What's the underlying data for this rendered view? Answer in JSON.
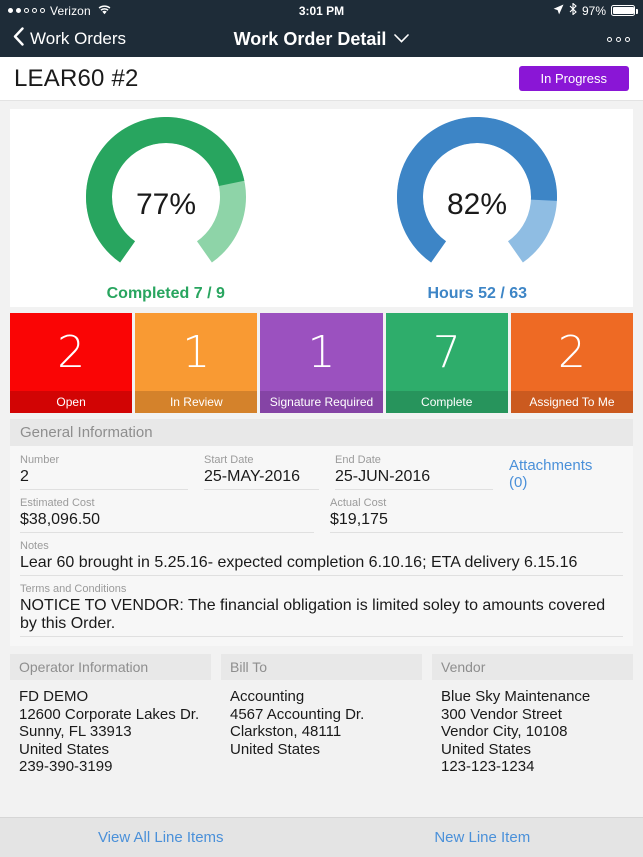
{
  "statusbar": {
    "carrier": "Verizon",
    "signal_dots_filled": 2,
    "signal_dots_total": 5,
    "wifi_icon": "wifi-icon",
    "time": "3:01 PM",
    "location_icon": "location-arrow-icon",
    "bluetooth_icon": "bluetooth-icon",
    "battery_percent": "97%",
    "battery_level": 97
  },
  "navbar": {
    "back_icon": "chevron-left-icon",
    "back_label": "Work Orders",
    "title": "Work Order Detail",
    "title_dropdown_icon": "chevron-down-icon",
    "more_icon": "more-horizontal-icon"
  },
  "header": {
    "work_order_title": "LEAR60 #2",
    "status_label": "In Progress",
    "status_color": "#8a16d6"
  },
  "gauges": [
    {
      "name": "completed",
      "percent_label": "77%",
      "percent_value": 77,
      "caption": "Completed 7 / 9",
      "completed": 7,
      "total": 9,
      "color": "#28a55f",
      "track_color": "#8ed4a8"
    },
    {
      "name": "hours",
      "percent_label": "82%",
      "percent_value": 82,
      "caption": "Hours 52 / 63",
      "completed": 52,
      "total": 63,
      "color": "#3d85c6",
      "track_color": "#8fbde3"
    }
  ],
  "tiles": [
    {
      "count": "2",
      "label": "Open",
      "color": "#fa0505",
      "footer_color": "#d20404"
    },
    {
      "count": "1",
      "label": "In Review",
      "color": "#f99a33",
      "footer_color": "#d4822b"
    },
    {
      "count": "1",
      "label": "Signature Required",
      "color": "#9b51bf",
      "footer_color": "#8544a5"
    },
    {
      "count": "7",
      "label": "Complete",
      "color": "#2ead6b",
      "footer_color": "#27945c"
    },
    {
      "count": "2",
      "label": "Assigned To Me",
      "color": "#ee6a24",
      "footer_color": "#cb5a1f"
    }
  ],
  "general_information": {
    "section_title": "General Information",
    "number": {
      "label": "Number",
      "value": "2"
    },
    "start_date": {
      "label": "Start Date",
      "value": "25-MAY-2016"
    },
    "end_date": {
      "label": "End Date",
      "value": "25-JUN-2016"
    },
    "attachments_link": "Attachments (0)",
    "estimated_cost": {
      "label": "Estimated Cost",
      "value": "$38,096.50"
    },
    "actual_cost": {
      "label": "Actual Cost",
      "value": "$19,175"
    },
    "notes": {
      "label": "Notes",
      "value": "Lear 60 brought in 5.25.16- expected completion 6.10.16; ETA delivery 6.15.16"
    },
    "terms": {
      "label": "Terms and Conditions",
      "value": "NOTICE TO VENDOR: The financial obligation is limited soley to amounts covered by this Order."
    }
  },
  "address_columns": [
    {
      "title": "Operator Information",
      "lines": [
        "FD DEMO",
        "12600 Corporate Lakes Dr.",
        "Sunny, FL 33913",
        "United States",
        "239-390-3199"
      ]
    },
    {
      "title": "Bill To",
      "lines": [
        "Accounting",
        "4567 Accounting Dr.",
        "Clarkston, 48111",
        "United States"
      ]
    },
    {
      "title": "Vendor",
      "lines": [
        "Blue Sky Maintenance",
        "300 Vendor Street",
        "Vendor City, 10108",
        "United States",
        "123-123-1234"
      ]
    }
  ],
  "bottombar": {
    "view_all_label": "View All Line Items",
    "new_item_label": "New Line Item"
  }
}
